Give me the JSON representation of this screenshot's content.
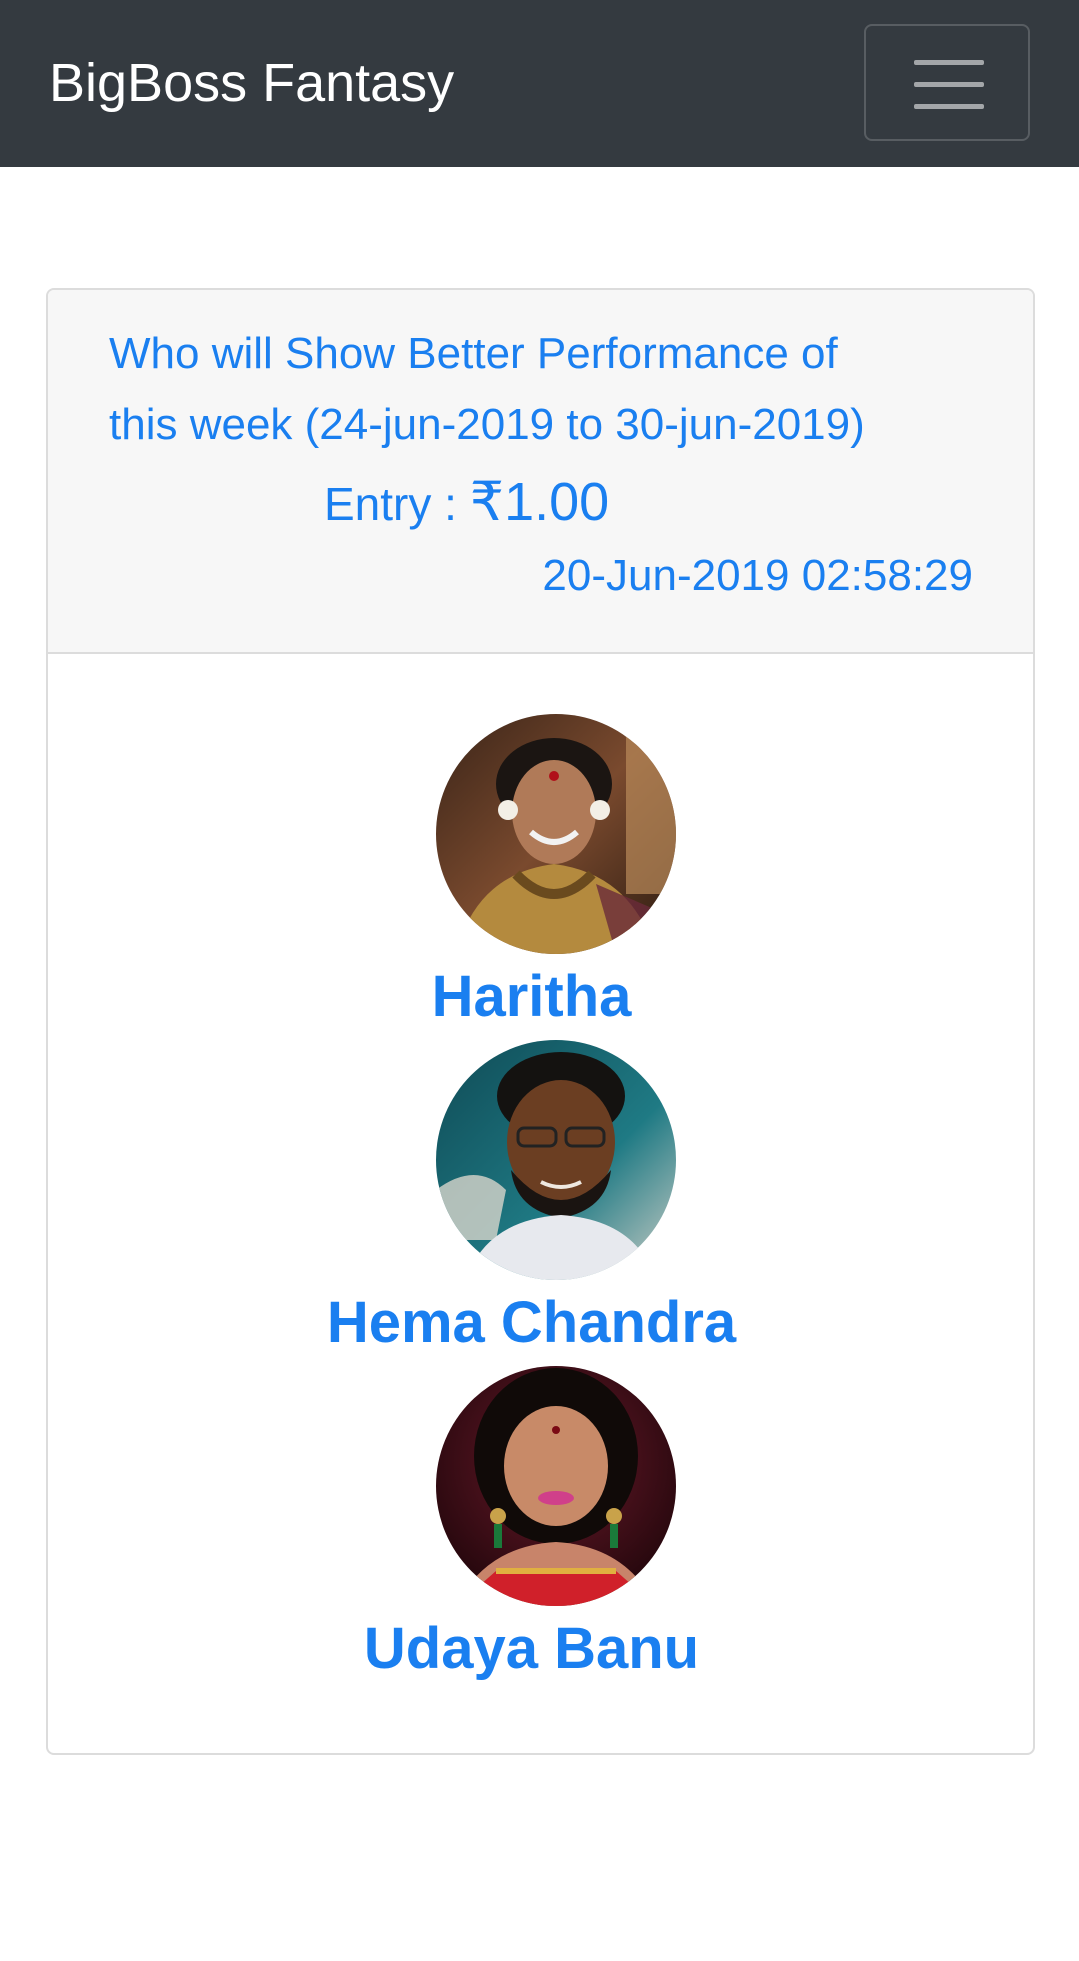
{
  "navbar": {
    "brand": "BigBoss Fantasy",
    "toggle_icon": "hamburger-menu-icon"
  },
  "contest": {
    "question_line1": "Who will Show Better Performance of",
    "question_line2": "this week (24-jun-2019 to 30-jun-2019)",
    "entry_label": "Entry : ",
    "currency_symbol": "₹",
    "entry_amount": "1.00",
    "timestamp": "20-Jun-2019 02:58:29"
  },
  "players": [
    {
      "name": "Haritha"
    },
    {
      "name": "Hema Chandra"
    },
    {
      "name": "Udaya Banu"
    }
  ],
  "colors": {
    "navbar_bg": "#343a40",
    "accent": "#1a7ff0",
    "card_header_bg": "#f7f7f7"
  }
}
